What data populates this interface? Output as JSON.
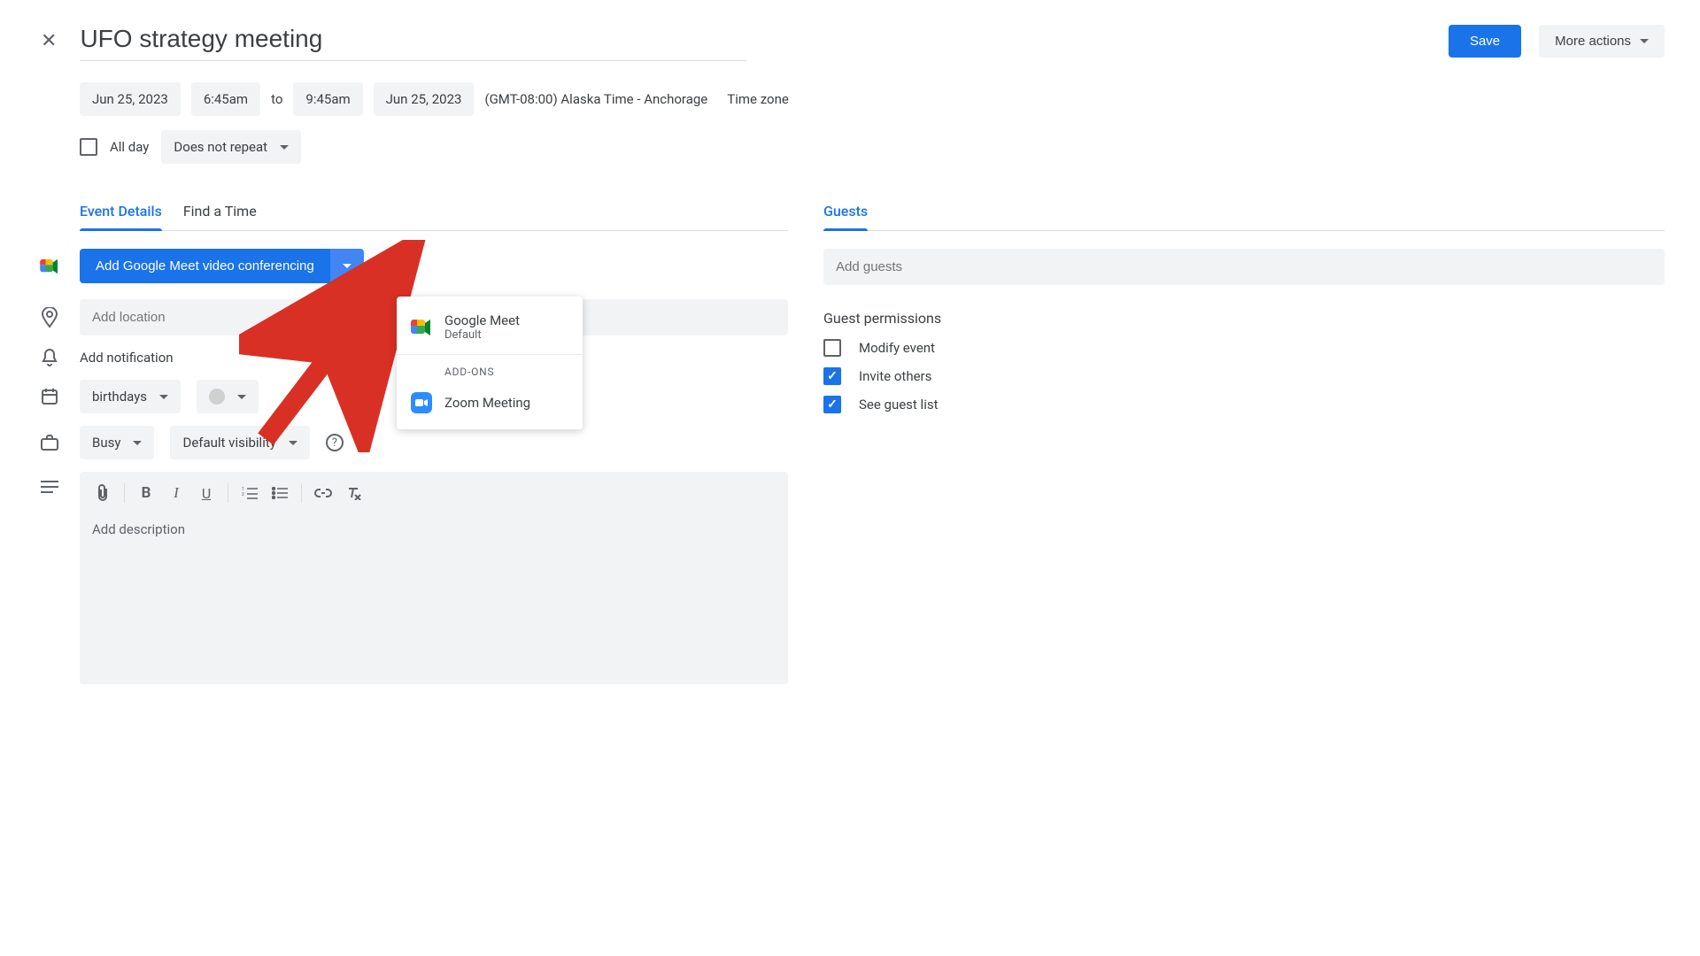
{
  "header": {
    "title": "UFO strategy meeting",
    "save": "Save",
    "more_actions": "More actions"
  },
  "datetime": {
    "start_date": "Jun 25, 2023",
    "start_time": "6:45am",
    "to": "to",
    "end_time": "9:45am",
    "end_date": "Jun 25, 2023",
    "timezone": "(GMT-08:00) Alaska Time - Anchorage",
    "timezone_link": "Time zone",
    "all_day": "All day",
    "repeat": "Does not repeat"
  },
  "tabs": {
    "details": "Event Details",
    "find_time": "Find a Time",
    "guests": "Guests"
  },
  "conferencing": {
    "button": "Add Google Meet video conferencing",
    "menu": {
      "google_meet": "Google Meet",
      "default": "Default",
      "addons": "ADD-ONS",
      "zoom": "Zoom Meeting"
    }
  },
  "location_placeholder": "Add location",
  "notification": "Add notification",
  "calendar": "birthdays",
  "availability": "Busy",
  "visibility": "Default visibility",
  "description_placeholder": "Add description",
  "guests_panel": {
    "placeholder": "Add guests",
    "perm_title": "Guest permissions",
    "modify": "Modify event",
    "invite": "Invite others",
    "see_list": "See guest list"
  }
}
